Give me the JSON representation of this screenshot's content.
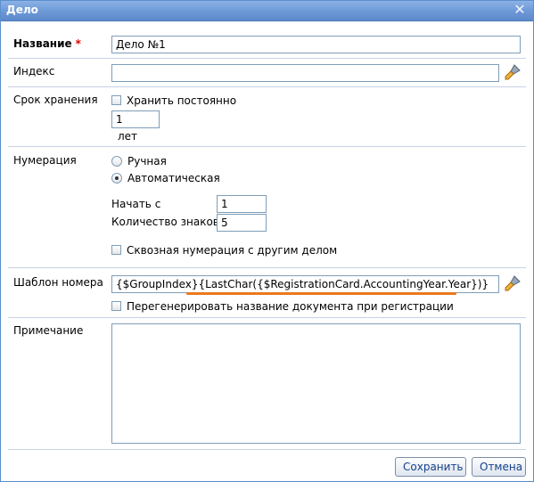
{
  "window": {
    "title": "Дело"
  },
  "fields": {
    "name_label": "Название",
    "name_required": "*",
    "name_value": "Дело №1",
    "index_label": "Индекс",
    "index_value": "",
    "retention_label": "Срок хранения",
    "keep_forever_label": "Хранить постоянно",
    "retention_value": "1",
    "retention_unit": "лет",
    "numbering_label": "Нумерация",
    "manual_label": "Ручная",
    "auto_label": "Автоматическая",
    "start_label": "Начать с",
    "start_value": "1",
    "digits_label": "Количество знаков",
    "digits_value": "5",
    "cross_numbering_label": "Сквозная нумерация с другим делом",
    "template_label": "Шаблон номера",
    "template_part1": "{$GroupIndex}",
    "template_part2": "{LastChar({$RegistrationCard.AccountingYear.Year})}",
    "regenerate_label": "Перегенерировать название документа при регистрации",
    "note_label": "Примечание",
    "note_value": ""
  },
  "buttons": {
    "save": "Сохранить",
    "cancel": "Отмена"
  },
  "state": {
    "keep_forever": false,
    "numbering_mode": "auto",
    "cross_numbering": false,
    "regenerate": false
  },
  "icons": {
    "close": "close-icon",
    "index_picker": "brush-icon",
    "template_picker": "brush-icon"
  },
  "colors": {
    "titlebar": "#6f9ad8",
    "required": "#dd0000",
    "highlight_underline": "#e8791f",
    "button_text": "#15428b"
  }
}
